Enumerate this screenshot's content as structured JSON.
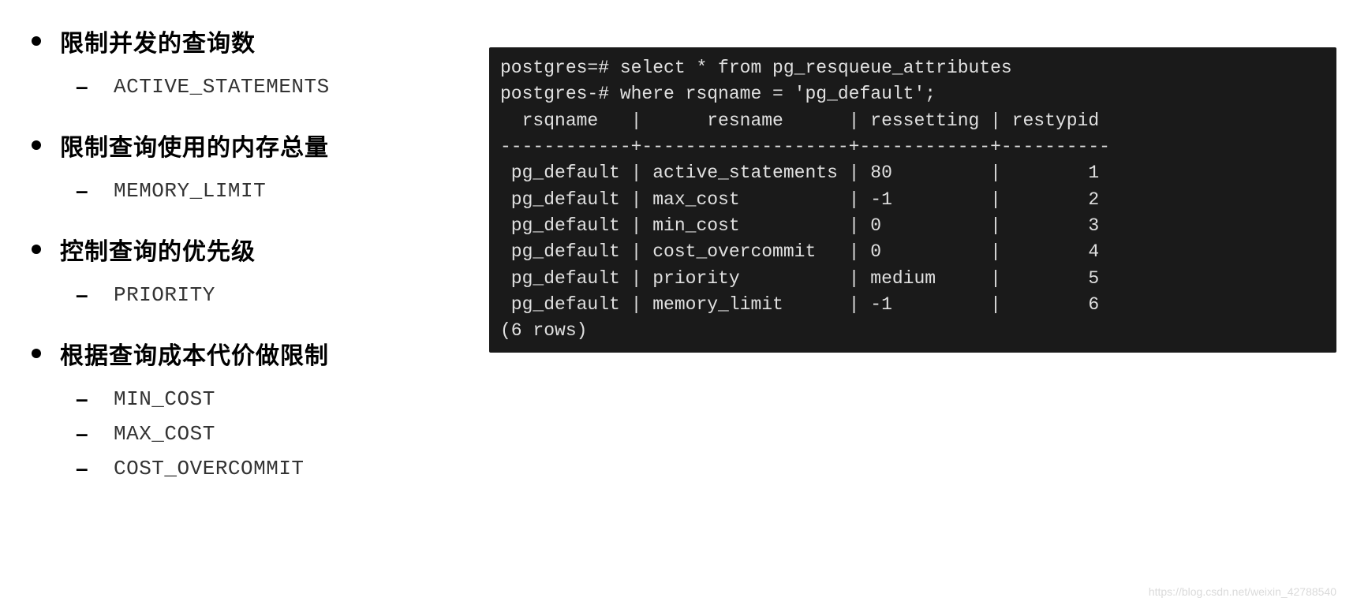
{
  "sections": [
    {
      "title": "限制并发的查询数",
      "subs": [
        "ACTIVE_STATEMENTS"
      ]
    },
    {
      "title": "限制查询使用的内存总量",
      "subs": [
        "MEMORY_LIMIT"
      ]
    },
    {
      "title": "控制查询的优先级",
      "subs": [
        "PRIORITY"
      ]
    },
    {
      "title": "根据查询成本代价做限制",
      "subs": [
        "MIN_COST",
        "MAX_COST",
        "COST_OVERCOMMIT"
      ]
    }
  ],
  "terminal": {
    "line1": "postgres=# select * from pg_resqueue_attributes",
    "line2": "postgres-# where rsqname = 'pg_default';",
    "header": "  rsqname   |      resname      | ressetting | restypid",
    "sep": "------------+-------------------+------------+----------",
    "rows": [
      " pg_default | active_statements | 80         |        1",
      " pg_default | max_cost          | -1         |        2",
      " pg_default | min_cost          | 0          |        3",
      " pg_default | cost_overcommit   | 0          |        4",
      " pg_default | priority          | medium     |        5",
      " pg_default | memory_limit      | -1         |        6"
    ],
    "footer": "(6 rows)"
  },
  "watermark": "https://blog.csdn.net/weixin_42788540"
}
